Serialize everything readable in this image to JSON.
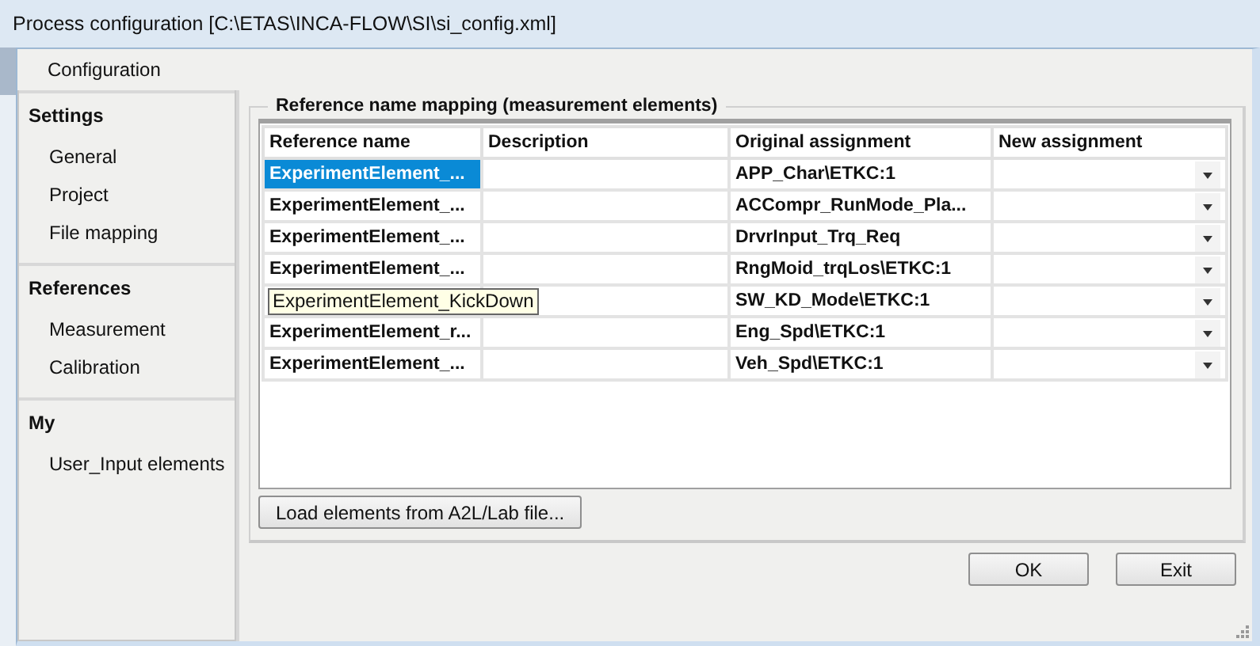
{
  "window": {
    "title": "Process configuration [C:\\ETAS\\INCA-FLOW\\SI\\si_config.xml]"
  },
  "sidebar": {
    "title": "Configuration",
    "groups": [
      {
        "label": "Settings",
        "items": [
          {
            "label": "General"
          },
          {
            "label": "Project"
          },
          {
            "label": "File mapping"
          }
        ]
      },
      {
        "label": "References",
        "items": [
          {
            "label": "Measurement"
          },
          {
            "label": "Calibration"
          }
        ]
      },
      {
        "label": "My",
        "items": [
          {
            "label": "User_Input elements"
          }
        ]
      }
    ]
  },
  "mapping": {
    "title": "Reference name mapping (measurement elements)",
    "columns": [
      "Reference name",
      "Description",
      "Original assignment",
      "New assignment"
    ],
    "rows": [
      {
        "reference_name": "ExperimentElement_...",
        "original_assignment": "APP_Char\\ETKC:1",
        "selected": true
      },
      {
        "reference_name": "ExperimentElement_...",
        "original_assignment": "ACCompr_RunMode_Pla...",
        "selected": false
      },
      {
        "reference_name": "ExperimentElement_...",
        "original_assignment": "DrvrInput_Trq_Req",
        "selected": false
      },
      {
        "reference_name": "ExperimentElement_...",
        "original_assignment": "RngMoid_trqLos\\ETKC:1",
        "selected": false
      },
      {
        "tooltip": "ExperimentElement_KickDown",
        "original_assignment": "SW_KD_Mode\\ETKC:1",
        "selected": false
      },
      {
        "reference_name": "ExperimentElement_r...",
        "original_assignment": "Eng_Spd\\ETKC:1",
        "selected": false
      },
      {
        "reference_name": "ExperimentElement_...",
        "original_assignment": "Veh_Spd\\ETKC:1",
        "selected": false
      }
    ],
    "load_button": "Load elements from A2L/Lab file..."
  },
  "buttons": [
    "OK",
    "Exit"
  ]
}
